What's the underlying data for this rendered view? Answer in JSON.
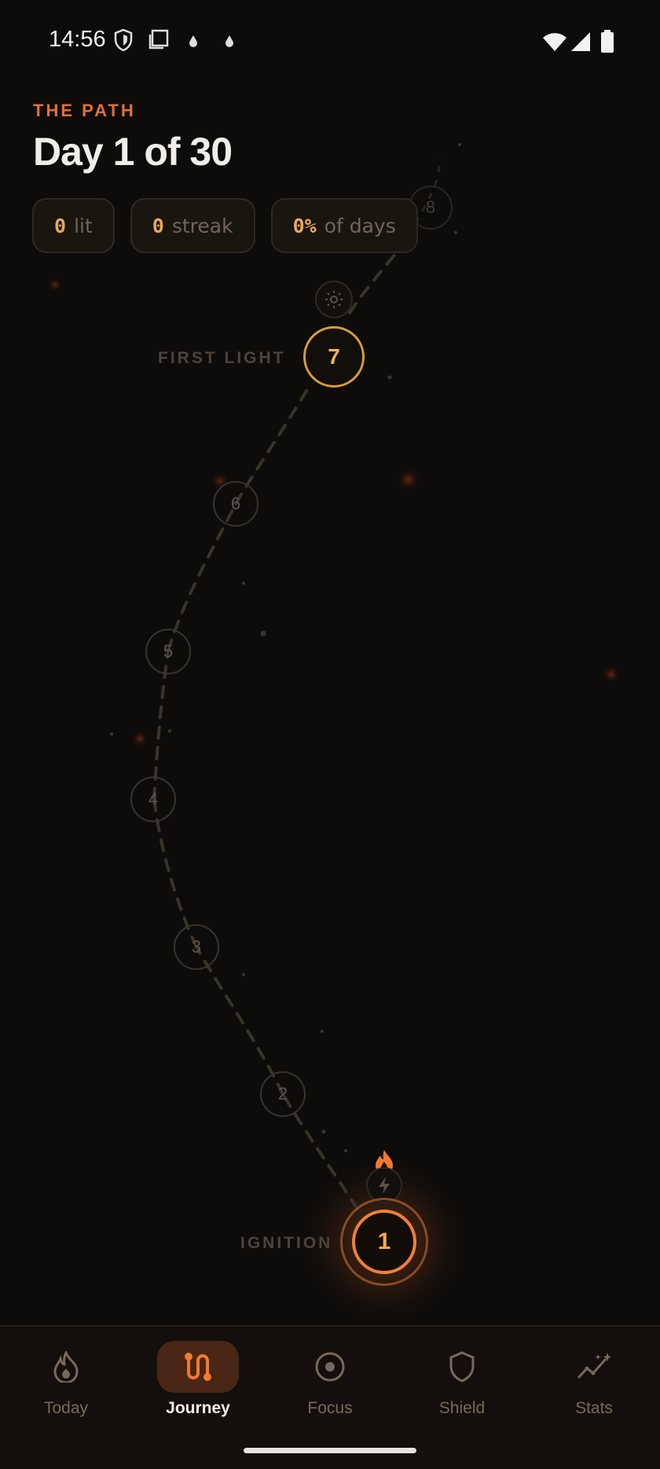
{
  "status_bar": {
    "time": "14:56"
  },
  "header": {
    "eyebrow": "THE PATH",
    "title": "Day 1 of 30"
  },
  "stats": {
    "lit": {
      "value": "0",
      "label": "lit"
    },
    "streak": {
      "value": "0",
      "label": "streak"
    },
    "days": {
      "value": "0%",
      "label": "of days"
    }
  },
  "milestones": {
    "first_light": {
      "label": "FIRST LIGHT",
      "day": "7"
    },
    "ignition": {
      "label": "IGNITION",
      "day": "1"
    }
  },
  "path_nodes": [
    "8",
    "6",
    "5",
    "4",
    "3",
    "2"
  ],
  "tabs": [
    {
      "label": "Today",
      "icon": "flame-icon",
      "active": false
    },
    {
      "label": "Journey",
      "icon": "journey-icon",
      "active": true
    },
    {
      "label": "Focus",
      "icon": "focus-icon",
      "active": false
    },
    {
      "label": "Shield",
      "icon": "shield-icon",
      "active": false
    },
    {
      "label": "Stats",
      "icon": "stats-icon",
      "active": false
    }
  ],
  "colors": {
    "accent": "#e0703a",
    "gold": "#d89b3a",
    "background": "#0e0c0a"
  }
}
